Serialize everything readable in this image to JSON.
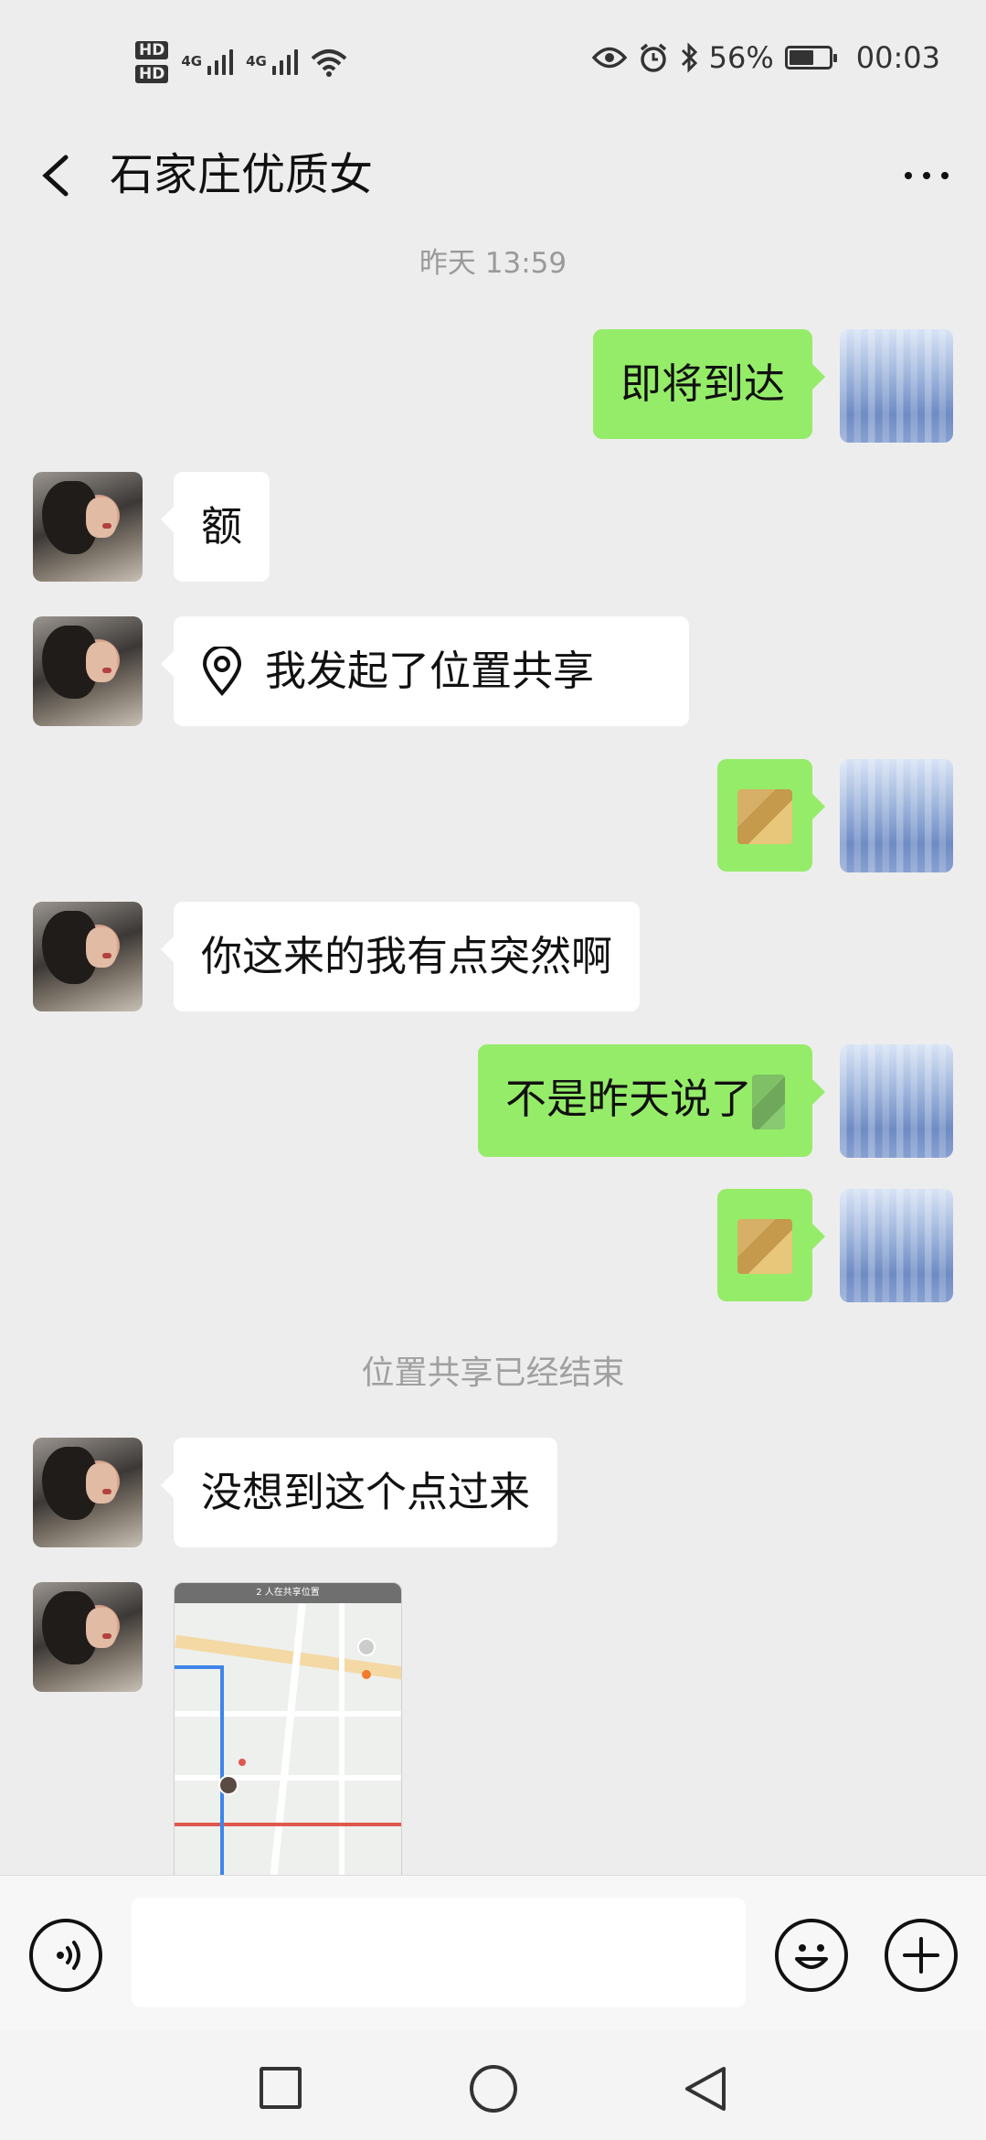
{
  "status_bar": {
    "hd1": "HD",
    "hd2": "HD",
    "net1": "4G",
    "net2": "4G",
    "battery_text": "56%",
    "time": "00:03"
  },
  "header": {
    "title": "石家庄优质女",
    "back_icon": "chevron-left-icon",
    "more_icon": "more-dots-icon"
  },
  "messages": {
    "timestamp": "昨天 13:59",
    "m1": "即将到达",
    "m2": "额",
    "m3": "我发起了位置共享",
    "m5": "你这来的我有点突然啊",
    "m6": "不是昨天说了",
    "system_note": "位置共享已经结束",
    "m8": "没想到这个点过来",
    "map_header": "2 人在共享位置"
  },
  "input_bar": {
    "placeholder": "",
    "voice_icon": "voice-icon",
    "emoji_icon": "emoji-icon",
    "plus_icon": "plus-icon"
  },
  "system_nav": {
    "recent_icon": "square-icon",
    "home_icon": "circle-icon",
    "back_icon": "triangle-back-icon"
  },
  "colors": {
    "outgoing_bubble": "#95ec69",
    "incoming_bubble": "#ffffff",
    "background": "#ededed"
  }
}
